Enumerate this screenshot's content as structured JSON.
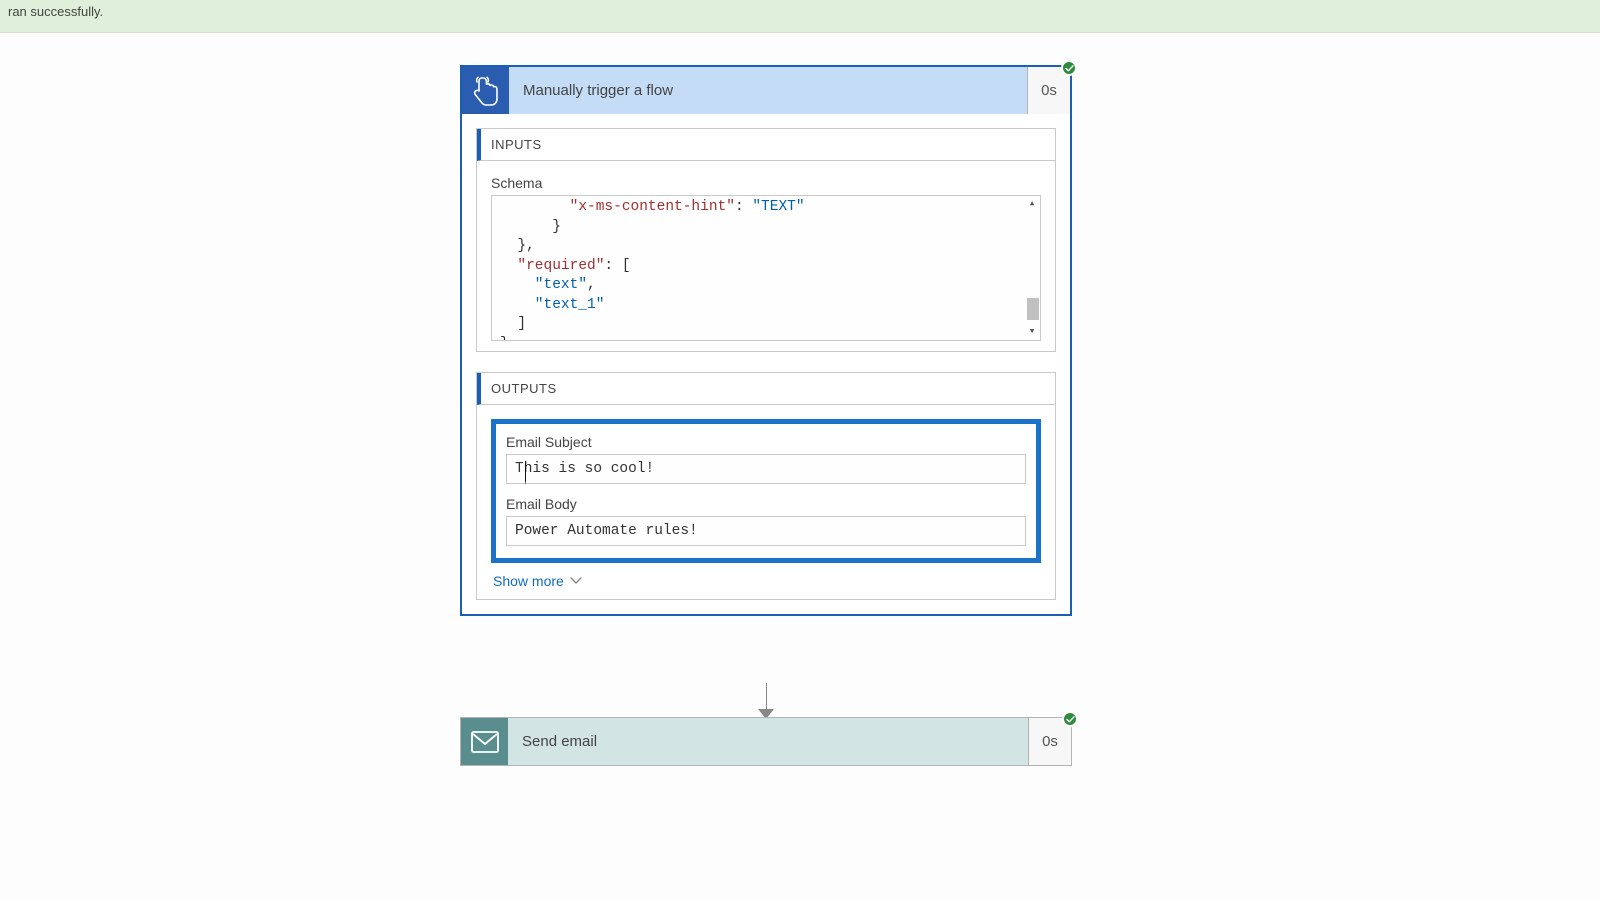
{
  "banner": {
    "text": "ran successfully."
  },
  "trigger": {
    "title": "Manually trigger a flow",
    "time": "0s",
    "inputs_label": "INPUTS",
    "schema_label": "Schema",
    "schema_lines": {
      "l0a": "        \"x-ms-content-hint\"",
      "l0b": ": ",
      "l0c": "\"TEXT\"",
      "l1": "      }",
      "l2": "  },",
      "l3a": "  \"required\"",
      "l3b": ": [",
      "l4a": "    \"text\"",
      "l4b": ",",
      "l5": "    \"text_1\"",
      "l6": "  ]",
      "l7": "}"
    },
    "outputs_label": "OUTPUTS",
    "fields": {
      "subject_label": "Email Subject",
      "subject_value": "This is so cool!",
      "body_label": "Email Body",
      "body_value": "Power Automate rules!"
    },
    "show_more": "Show more"
  },
  "email": {
    "title": "Send email",
    "time": "0s"
  }
}
